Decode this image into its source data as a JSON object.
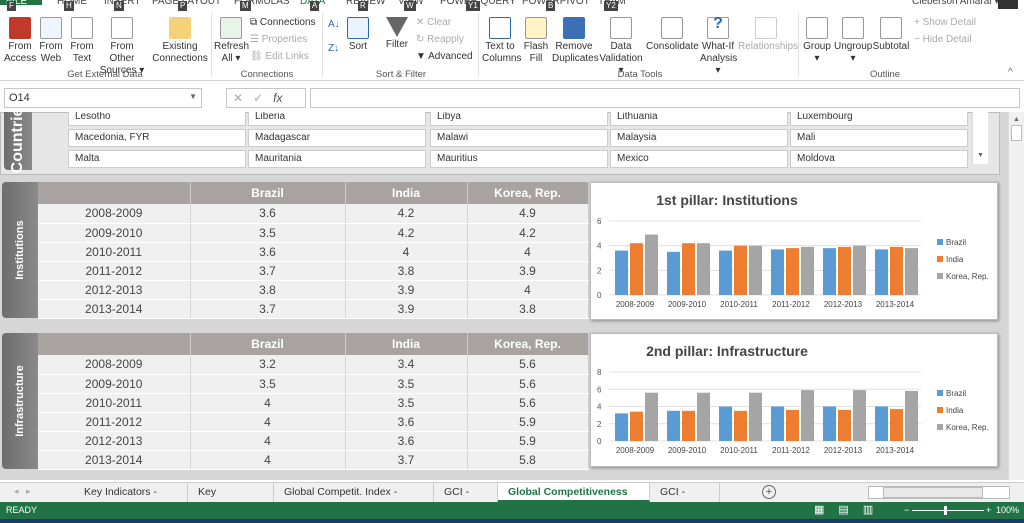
{
  "ribbon_tabs": [
    {
      "label": "FILE",
      "key": "F"
    },
    {
      "label": "HOME",
      "key": "H"
    },
    {
      "label": "INSERT",
      "key": "N"
    },
    {
      "label": "PAGE LAYOUT",
      "key": "P"
    },
    {
      "label": "FORMULAS",
      "key": "M"
    },
    {
      "label": "DATA",
      "key": "A"
    },
    {
      "label": "REVIEW",
      "key": "R"
    },
    {
      "label": "VIEW",
      "key": "W"
    },
    {
      "label": "POWER QUERY",
      "key": "Y1"
    },
    {
      "label": "POWERPIVOT",
      "key": "B"
    },
    {
      "label": "TEAM",
      "key": "Y2"
    }
  ],
  "user": "Cleberson Amaral ▾",
  "ribbon": {
    "get_external": {
      "from_access": "From Access",
      "from_web": "From Web",
      "from_text": "From Text",
      "from_other": "From Other Sources ▾",
      "existing": "Existing Connections",
      "group": "Get External Data"
    },
    "connections": {
      "refresh": "Refresh All ▾",
      "connections": "Connections",
      "properties": "Properties",
      "edit_links": "Edit Links",
      "group": "Connections"
    },
    "sort_filter": {
      "sort": "Sort",
      "filter": "Filter",
      "clear": "Clear",
      "reapply": "Reapply",
      "advanced": "Advanced",
      "group": "Sort & Filter"
    },
    "data_tools": {
      "text_to_columns": "Text to Columns",
      "flash_fill": "Flash Fill",
      "remove_duplicates": "Remove Duplicates",
      "data_validation": "Data Validation ▾",
      "consolidate": "Consolidate",
      "what_if": "What-If Analysis ▾",
      "relationships": "Relationships",
      "group": "Data Tools"
    },
    "outline": {
      "group_btn": "Group",
      "ungroup": "Ungroup",
      "subtotal": "Subtotal",
      "show_detail": "Show Detail",
      "hide_detail": "Hide Detail",
      "group": "Outline"
    }
  },
  "formula_bar": {
    "name_box": "O14",
    "fx": "fx",
    "value": ""
  },
  "countries": {
    "tab": "Countries",
    "rows": [
      [
        "Lesotho",
        "Liberia",
        "Libya",
        "Lithuania",
        "Luxembourg"
      ],
      [
        "Macedonia, FYR",
        "Madagascar",
        "Malawi",
        "Malaysia",
        "Mali"
      ],
      [
        "Malta",
        "Mauritania",
        "Mauritius",
        "Mexico",
        "Moldova"
      ]
    ]
  },
  "pillars": [
    {
      "tab": "Institutions",
      "headers": [
        "",
        "Brazil",
        "India",
        "Korea, Rep."
      ],
      "rows": [
        [
          "2008-2009",
          "3.6",
          "4.2",
          "4.9"
        ],
        [
          "2009-2010",
          "3.5",
          "4.2",
          "4.2"
        ],
        [
          "2010-2011",
          "3.6",
          "4",
          "4"
        ],
        [
          "2011-2012",
          "3.7",
          "3.8",
          "3.9"
        ],
        [
          "2012-2013",
          "3.8",
          "3.9",
          "4"
        ],
        [
          "2013-2014",
          "3.7",
          "3.9",
          "3.8"
        ]
      ]
    },
    {
      "tab": "Infrastructure",
      "headers": [
        "",
        "Brazil",
        "India",
        "Korea, Rep."
      ],
      "rows": [
        [
          "2008-2009",
          "3.2",
          "3.4",
          "5.6"
        ],
        [
          "2009-2010",
          "3.5",
          "3.5",
          "5.6"
        ],
        [
          "2010-2011",
          "4",
          "3.5",
          "5.6"
        ],
        [
          "2011-2012",
          "4",
          "3.6",
          "5.9"
        ],
        [
          "2012-2013",
          "4",
          "3.6",
          "5.9"
        ],
        [
          "2013-2014",
          "4",
          "3.7",
          "5.8"
        ]
      ]
    }
  ],
  "chart_data": [
    {
      "type": "bar",
      "title": "1st pillar: Institutions",
      "categories": [
        "2008-2009",
        "2009-2010",
        "2010-2011",
        "2011-2012",
        "2012-2013",
        "2013-2014"
      ],
      "ylim": [
        0,
        6
      ],
      "yticks": [
        0,
        2,
        4,
        6
      ],
      "grid": true,
      "legend": "right",
      "series": [
        {
          "name": "Brazil",
          "color": "#5b9bd5",
          "values": [
            3.6,
            3.5,
            3.6,
            3.7,
            3.8,
            3.7
          ]
        },
        {
          "name": "India",
          "color": "#ed7d31",
          "values": [
            4.2,
            4.2,
            4,
            3.8,
            3.9,
            3.9
          ]
        },
        {
          "name": "Korea, Rep.",
          "color": "#a5a5a5",
          "values": [
            4.9,
            4.2,
            4,
            3.9,
            4,
            3.8
          ]
        }
      ]
    },
    {
      "type": "bar",
      "title": "2nd pillar: Infrastructure",
      "categories": [
        "2008-2009",
        "2009-2010",
        "2010-2011",
        "2011-2012",
        "2012-2013",
        "2013-2014"
      ],
      "ylim": [
        0,
        8
      ],
      "yticks": [
        0,
        2,
        4,
        6,
        8
      ],
      "grid": true,
      "legend": "right",
      "series": [
        {
          "name": "Brazil",
          "color": "#5b9bd5",
          "values": [
            3.2,
            3.5,
            4,
            4,
            4,
            4
          ]
        },
        {
          "name": "India",
          "color": "#ed7d31",
          "values": [
            3.4,
            3.5,
            3.5,
            3.6,
            3.6,
            3.7
          ]
        },
        {
          "name": "Korea, Rep.",
          "color": "#a5a5a5",
          "values": [
            5.6,
            5.6,
            5.6,
            5.9,
            5.9,
            5.8
          ]
        }
      ]
    }
  ],
  "sheet_tabs": [
    "Key Indicators - Data",
    "Key Indicators",
    "Global Competit. Index - Dados",
    "GCI - Radar",
    "Global Competitiveness Index",
    "GCI - Trends"
  ],
  "active_sheet": "Global Competitiveness Index",
  "status": {
    "text": "READY",
    "zoom": "100%"
  },
  "accent": "#217346"
}
